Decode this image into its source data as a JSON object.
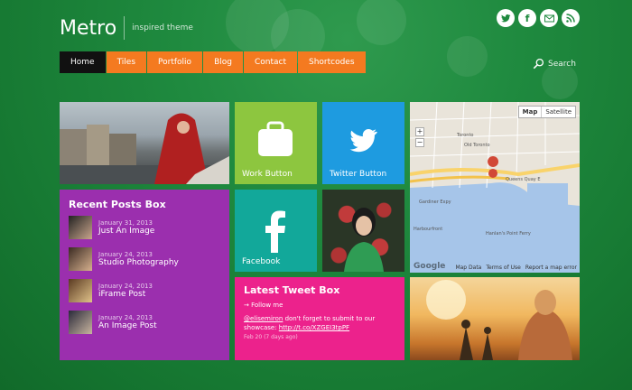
{
  "header": {
    "logo_title": "Metro",
    "logo_subtitle": "inspired theme"
  },
  "social": [
    "twitter-icon",
    "facebook-icon",
    "email-icon",
    "rss-icon"
  ],
  "nav": {
    "items": [
      {
        "label": "Home",
        "active": true
      },
      {
        "label": "Tiles"
      },
      {
        "label": "Portfolio"
      },
      {
        "label": "Blog"
      },
      {
        "label": "Contact"
      },
      {
        "label": "Shortcodes"
      }
    ]
  },
  "search": {
    "label": "Search"
  },
  "tiles": {
    "work": {
      "label": "Work Button"
    },
    "twitter": {
      "label": "Twitter Button"
    },
    "facebook": {
      "label": "Facebook"
    }
  },
  "recent": {
    "title": "Recent Posts Box",
    "posts": [
      {
        "date": "January 31, 2013",
        "title": "Just An Image"
      },
      {
        "date": "January 24, 2013",
        "title": "Studio Photography"
      },
      {
        "date": "January 24, 2013",
        "title": "iFrame Post"
      },
      {
        "date": "January 24, 2013",
        "title": "An Image Post"
      }
    ]
  },
  "tweet": {
    "title": "Latest Tweet Box",
    "follow": "→ Follow me",
    "handle": "@elisemiron",
    "text": " don't forget to submit to our showcase: ",
    "link": "http://t.co/XZGEI3tpPF",
    "date": "Feb 20 (7 days ago)"
  },
  "map": {
    "tab_map": "Map",
    "tab_satellite": "Satellite",
    "zoom_in": "+",
    "zoom_out": "−",
    "google": "Google",
    "footer_data": "Map Data",
    "footer_terms": "Terms of Use",
    "footer_report": "Report a map error",
    "labels": [
      "Toronto",
      "Old Toronto",
      "Gardiner Expy",
      "Harbourfront",
      "Queens Quay E",
      "Hanlan's Point Ferry"
    ]
  },
  "colors": {
    "background": "#1f8a3f",
    "nav_accent": "#f47a20",
    "work_tile": "#8dc63f",
    "twitter_tile": "#1e9be0",
    "facebook_tile": "#12a89a",
    "recent_tile": "#9b2fae",
    "tweet_tile": "#ec228c"
  }
}
